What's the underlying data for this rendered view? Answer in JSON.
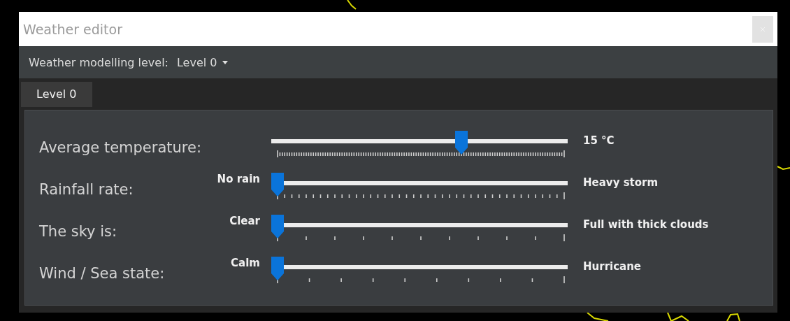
{
  "window": {
    "title": "Weather editor"
  },
  "toolbar": {
    "label": "Weather modelling level:",
    "dropdown": {
      "value": "Level 0"
    }
  },
  "tabs": [
    {
      "label": "Level 0",
      "selected": true
    }
  ],
  "sliders": [
    {
      "name": "Average temperature:",
      "kind": "dense",
      "level": 0.648,
      "reading": "15 °C"
    },
    {
      "name": "Rainfall rate:",
      "kind": "medium",
      "level": 0,
      "min_label": "No rain",
      "max_label": "Heavy storm"
    },
    {
      "name": "The sky is:",
      "kind": "ten",
      "level": 0,
      "min_label": "Clear",
      "max_label": "Full with thick clouds"
    },
    {
      "name": "Wind / Sea state:",
      "kind": "nine",
      "level": 0,
      "min_label": "Calm",
      "max_label": "Hurricane"
    }
  ]
}
